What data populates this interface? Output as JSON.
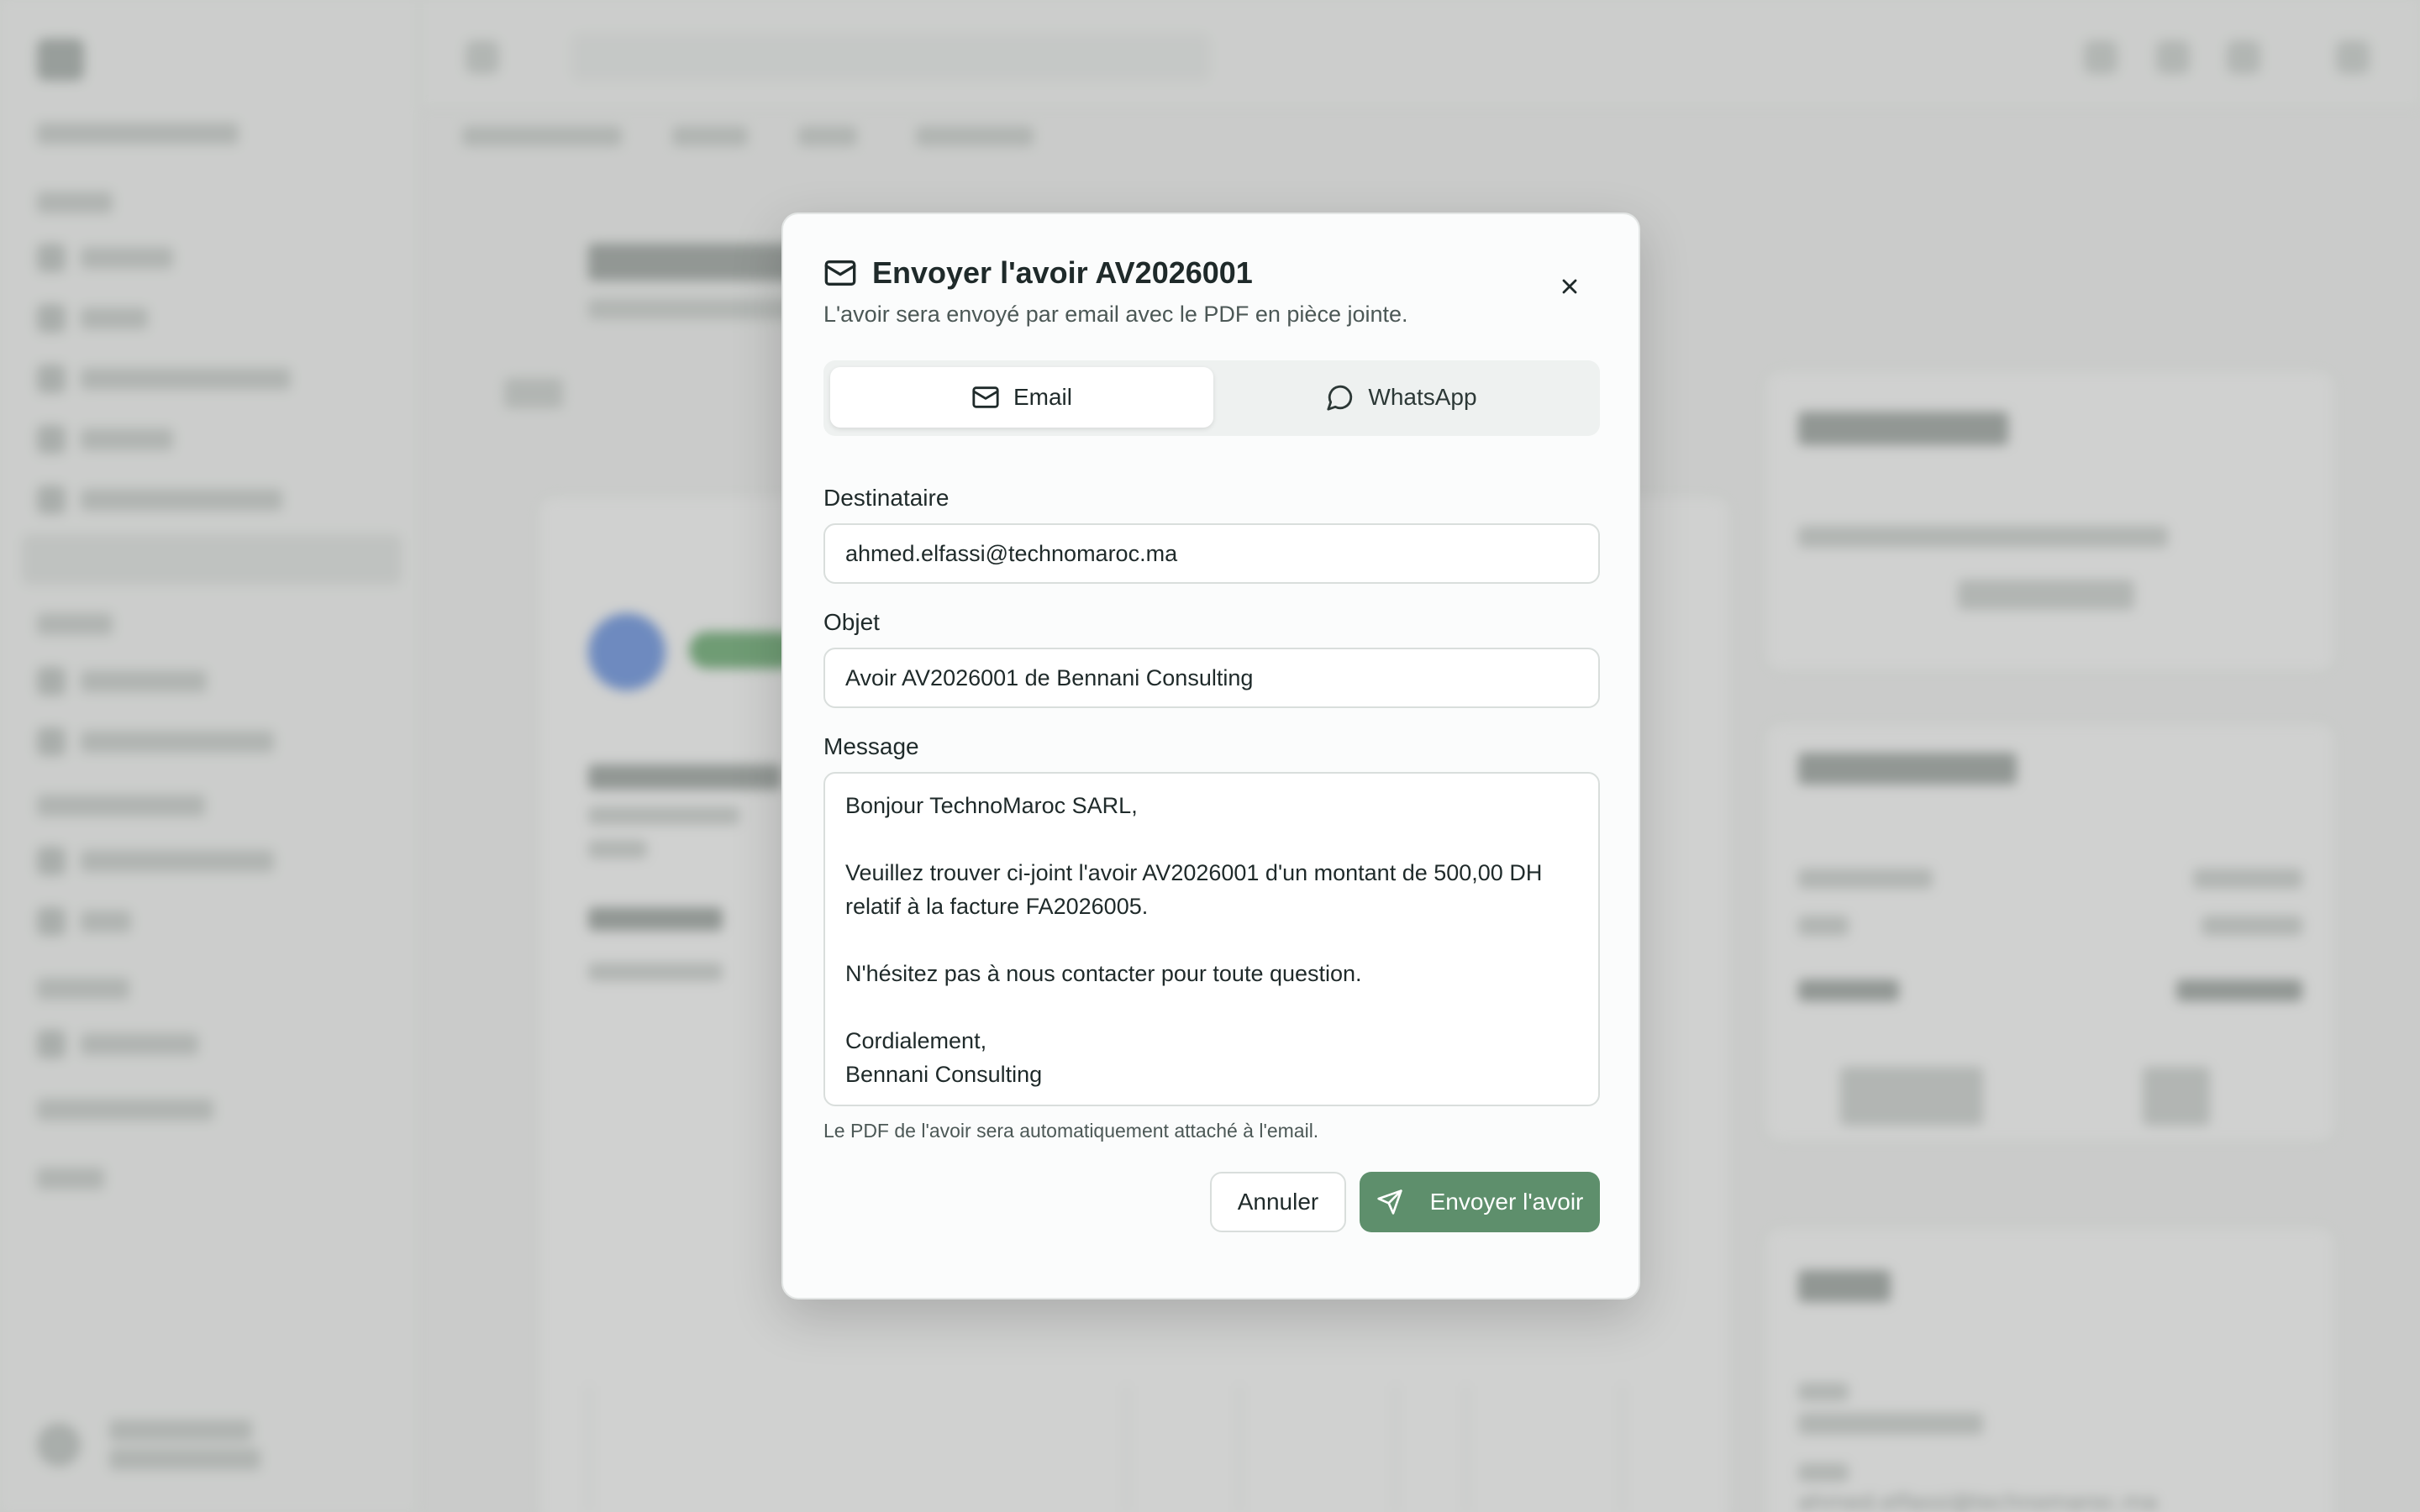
{
  "background": {
    "blurred_email": "ahmed.elfassi@technomaroc.ma"
  },
  "modal": {
    "title": "Envoyer l'avoir AV2026001",
    "subtitle": "L'avoir sera envoyé par email avec le PDF en pièce jointe.",
    "title_icon": "mail-icon",
    "close_icon": "close-icon",
    "tabs": [
      {
        "label": "Email",
        "icon": "mail-icon",
        "active": true
      },
      {
        "label": "WhatsApp",
        "icon": "message-circle-icon",
        "active": false
      }
    ],
    "recipient": {
      "label": "Destinataire",
      "value": "ahmed.elfassi@technomaroc.ma"
    },
    "subject": {
      "label": "Objet",
      "value": "Avoir AV2026001 de Bennani Consulting"
    },
    "message": {
      "label": "Message",
      "value": "Bonjour TechnoMaroc SARL,\n\nVeuillez trouver ci-joint l'avoir AV2026001 d'un montant de 500,00 DH\nrelatif à la facture FA2026005.\n\nN'hésitez pas à nous contacter pour toute question.\n\nCordialement,\nBennani Consulting"
    },
    "hint": "Le PDF de l'avoir sera automatiquement attaché à l'email.",
    "cancel_label": "Annuler",
    "send_label": "Envoyer l'avoir",
    "send_icon": "send-icon"
  },
  "colors": {
    "accent": "#5e8f6c",
    "overlay": "#969997"
  }
}
